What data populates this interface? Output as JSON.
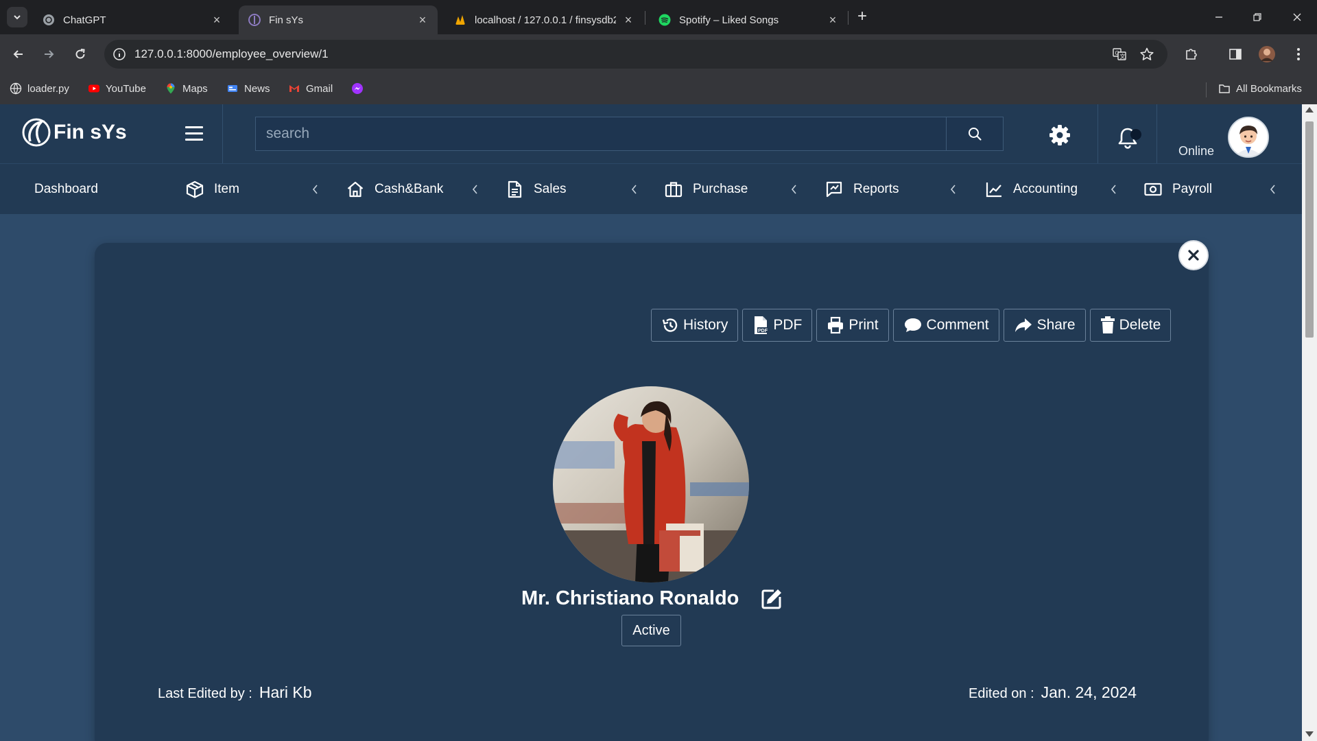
{
  "browser": {
    "tabs": [
      {
        "title": "ChatGPT",
        "icon": "chatgpt-icon",
        "active": false
      },
      {
        "title": "Fin sYs",
        "icon": "finsys-icon",
        "active": true
      },
      {
        "title": "localhost / 127.0.0.1 / finsysdb2",
        "icon": "phpmyadmin-icon",
        "active": false
      },
      {
        "title": "Spotify – Liked Songs",
        "icon": "spotify-icon",
        "active": false
      }
    ],
    "url": "127.0.0.1:8000/employee_overview/1",
    "bookmarks": [
      {
        "label": "loader.py",
        "icon": "globe-icon"
      },
      {
        "label": "YouTube",
        "icon": "youtube-icon"
      },
      {
        "label": "Maps",
        "icon": "maps-icon"
      },
      {
        "label": "News",
        "icon": "news-icon"
      },
      {
        "label": "Gmail",
        "icon": "gmail-icon"
      },
      {
        "label": "",
        "icon": "messenger-icon"
      }
    ],
    "all_bookmarks": "All Bookmarks"
  },
  "app": {
    "brand": "Fin sYs",
    "search_placeholder": "search",
    "status_label": "Online",
    "nav": [
      {
        "label": "Dashboard",
        "icon": ""
      },
      {
        "label": "Item",
        "icon": "box-icon"
      },
      {
        "label": "Cash&Bank",
        "icon": "home-icon"
      },
      {
        "label": "Sales",
        "icon": "document-icon"
      },
      {
        "label": "Purchase",
        "icon": "briefcase-icon"
      },
      {
        "label": "Reports",
        "icon": "report-icon"
      },
      {
        "label": "Accounting",
        "icon": "line-chart-icon"
      },
      {
        "label": "Payroll",
        "icon": "money-icon"
      }
    ]
  },
  "employee": {
    "actions": [
      "History",
      "PDF",
      "Print",
      "Comment",
      "Share",
      "Delete"
    ],
    "name": "Mr. Christiano Ronaldo",
    "status": "Active",
    "last_edited_label": "Last Edited by :",
    "last_edited_by": "Hari Kb",
    "edited_on_label": "Edited on :",
    "edited_on": "Jan. 24, 2024"
  },
  "colors": {
    "page_bg": "#2e4b6a",
    "header_bg": "#223a54",
    "card_bg": "#223a54"
  }
}
